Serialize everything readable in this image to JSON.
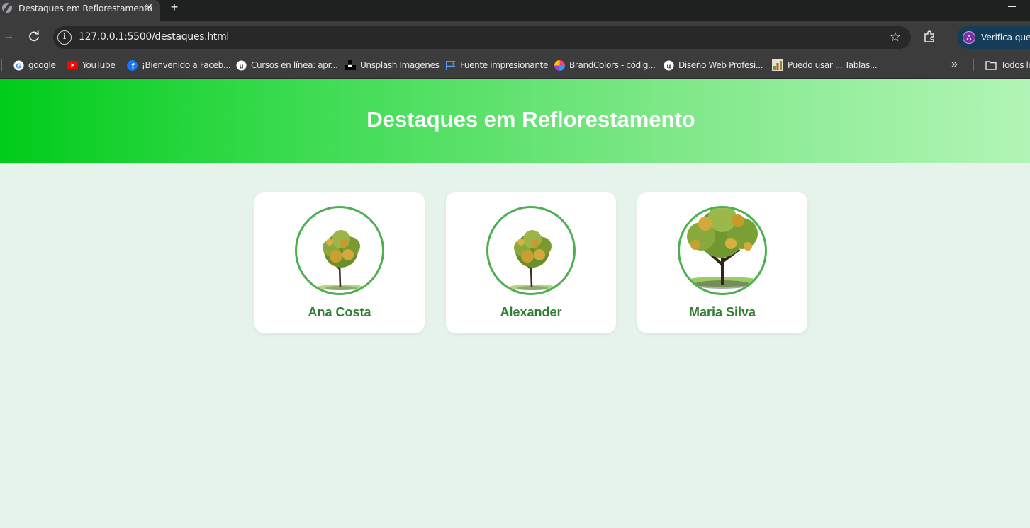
{
  "browser": {
    "tab_title": "Destaques em Reflorestamento",
    "url": "127.0.0.1:5500/destaques.html",
    "profile_label": "Verifica que e",
    "profile_initial": "A"
  },
  "bookmarks": [
    {
      "label": "google",
      "icon": "google-icon"
    },
    {
      "label": "YouTube",
      "icon": "youtube-icon"
    },
    {
      "label": "¡Bienvenido a Faceb...",
      "icon": "facebook-icon"
    },
    {
      "label": "Cursos en línea: apr...",
      "icon": "udemy-icon"
    },
    {
      "label": "Unsplash Imagenes",
      "icon": "unsplash-icon"
    },
    {
      "label": "Fuente impresionante",
      "icon": "flag-icon"
    },
    {
      "label": "BrandColors - códig...",
      "icon": "brandcolors-icon"
    },
    {
      "label": "Diseño Web Profesi...",
      "icon": "udemy-icon"
    },
    {
      "label": "Puedo usar ... Tablas...",
      "icon": "caniuse-icon"
    }
  ],
  "bookmarks_overflow": "»",
  "all_bookmarks_label": "Todos lo",
  "page": {
    "title": "Destaques em Reflorestamento",
    "cards": [
      {
        "name": "Ana Costa"
      },
      {
        "name": "Alexander"
      },
      {
        "name": "Maria Silva"
      }
    ]
  },
  "colors": {
    "header_gradient_start": "#00cc1a",
    "header_gradient_end": "#b2f5b6",
    "page_background": "#e6f3eb",
    "card_border": "#4caf50",
    "card_name": "#2e7d32"
  }
}
